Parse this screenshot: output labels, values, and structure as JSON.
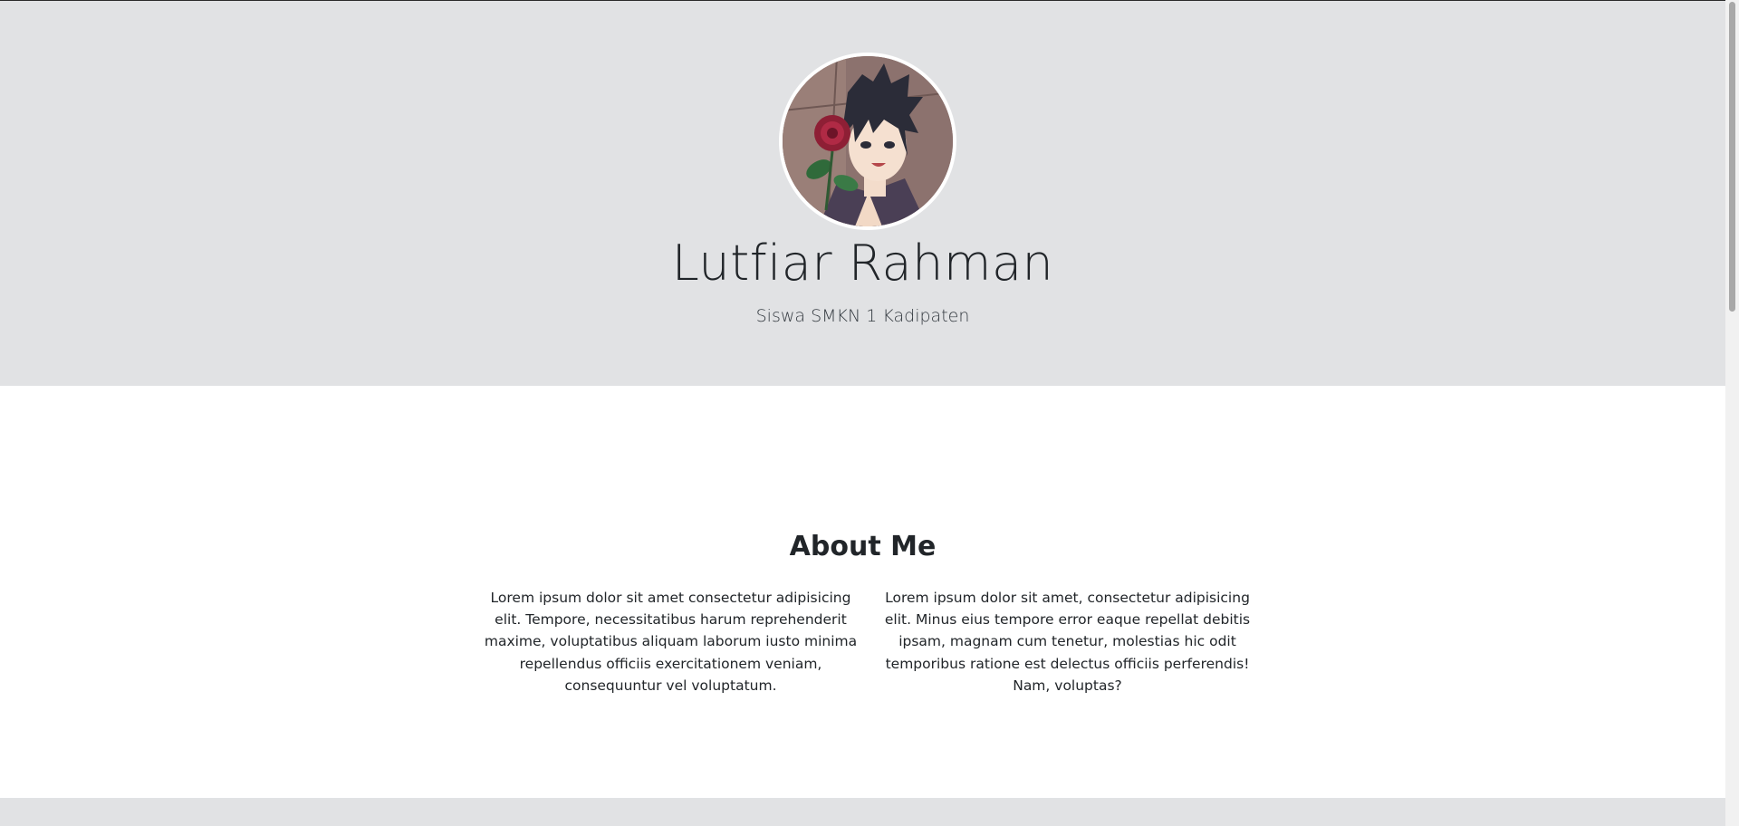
{
  "header": {
    "name": "Lutfiar Rahman",
    "tagline": "Siswa SMKN 1 Kadipaten",
    "background_color": "#e1e2e4"
  },
  "about": {
    "title": "About Me",
    "paragraphs": [
      "Lorem ipsum dolor sit amet consectetur adipisicing elit. Tempore, necessitatibus harum reprehenderit maxime, voluptatibus aliquam laborum iusto minima repellendus officiis exercitationem veniam, consequuntur vel voluptatum.",
      "Lorem ipsum dolor sit amet, consectetur adipisicing elit. Minus eius tempore error eaque repellat debitis ipsam, magnam cum tenetur, molestias hic odit temporibus ratione est delectus officiis perferendis! Nam, voluptas?"
    ]
  }
}
